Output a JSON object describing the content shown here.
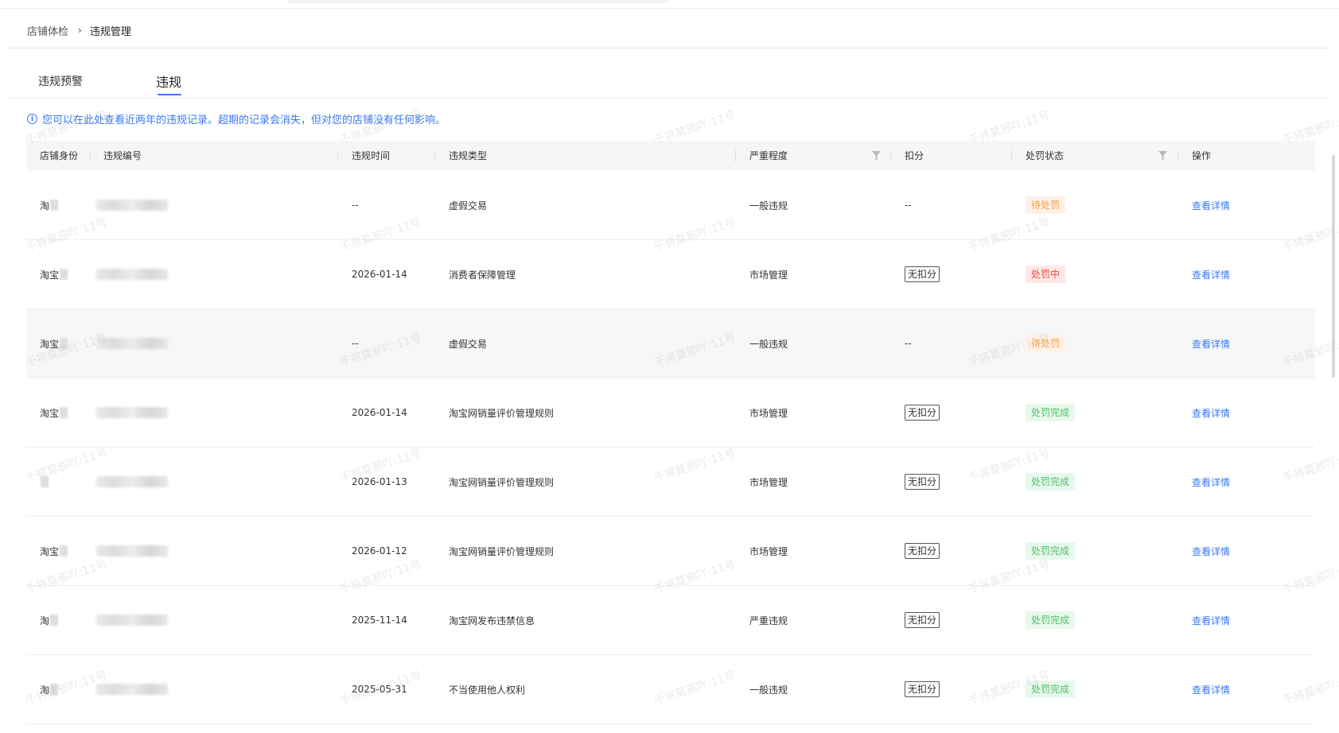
{
  "breadcrumb": {
    "parent": "店铺体检",
    "separator": "›",
    "current": "违规管理"
  },
  "tabs": [
    {
      "label": "违规预警"
    },
    {
      "label": "违规"
    }
  ],
  "notice": {
    "icon": "info-icon",
    "text": "您可以在此处查看近两年的违规记录。超期的记录会消失，但对您的店铺没有任何影响。"
  },
  "table": {
    "columns": {
      "shop": "店铺身份",
      "code": "违规编号",
      "time": "违规时间",
      "type": "违规类型",
      "severity": "严重程度",
      "deduct": "扣分",
      "status": "处罚状态",
      "op": "操作"
    },
    "rows": [
      {
        "shop": "淘",
        "time": "--",
        "type": "虚假交易",
        "severity": "一般违规",
        "deduct": "--",
        "status": "待处罚",
        "op": "查看详情"
      },
      {
        "shop": "淘宝",
        "time": "2026-01-14",
        "type": "消费者保障管理",
        "severity": "市场管理",
        "deduct": "无扣分",
        "status": "处罚中",
        "op": "查看详情"
      },
      {
        "shop": "淘宝",
        "time": "--",
        "type": "虚假交易",
        "severity": "一般违规",
        "deduct": "--",
        "status": "待处罚",
        "op": "查看详情"
      },
      {
        "shop": "淘宝",
        "time": "2026-01-14",
        "type": "淘宝网销量评价管理规则",
        "severity": "市场管理",
        "deduct": "无扣分",
        "status": "处罚完成",
        "op": "查看详情"
      },
      {
        "shop": "",
        "time": "2026-01-13",
        "type": "淘宝网销量评价管理规则",
        "severity": "市场管理",
        "deduct": "无扣分",
        "status": "处罚完成",
        "op": "查看详情"
      },
      {
        "shop": "淘宝",
        "time": "2026-01-12",
        "type": "淘宝网销量评价管理规则",
        "severity": "市场管理",
        "deduct": "无扣分",
        "status": "处罚完成",
        "op": "查看详情"
      },
      {
        "shop": "淘",
        "time": "2025-11-14",
        "type": "淘宝网发布违禁信息",
        "severity": "严重违规",
        "deduct": "无扣分",
        "status": "处罚完成",
        "op": "查看详情"
      },
      {
        "shop": "淘",
        "time": "2025-05-31",
        "type": "不当使用他人权利",
        "severity": "一般违规",
        "deduct": "无扣分",
        "status": "处罚完成",
        "op": "查看详情"
      }
    ]
  },
  "status_colors": {
    "待处罚": {
      "fg": "#f5a04a",
      "bg": "#fff1e6"
    },
    "处罚中": {
      "fg": "#f0483e",
      "bg": "#ffe8e6"
    },
    "处罚完成": {
      "fg": "#4ec16a",
      "bg": "#e8f8ec"
    }
  },
  "colors": {
    "accent": "#3a78f2",
    "header_bg": "#f5f6f8"
  },
  "watermark_text": "千将莫邪吖:11号"
}
